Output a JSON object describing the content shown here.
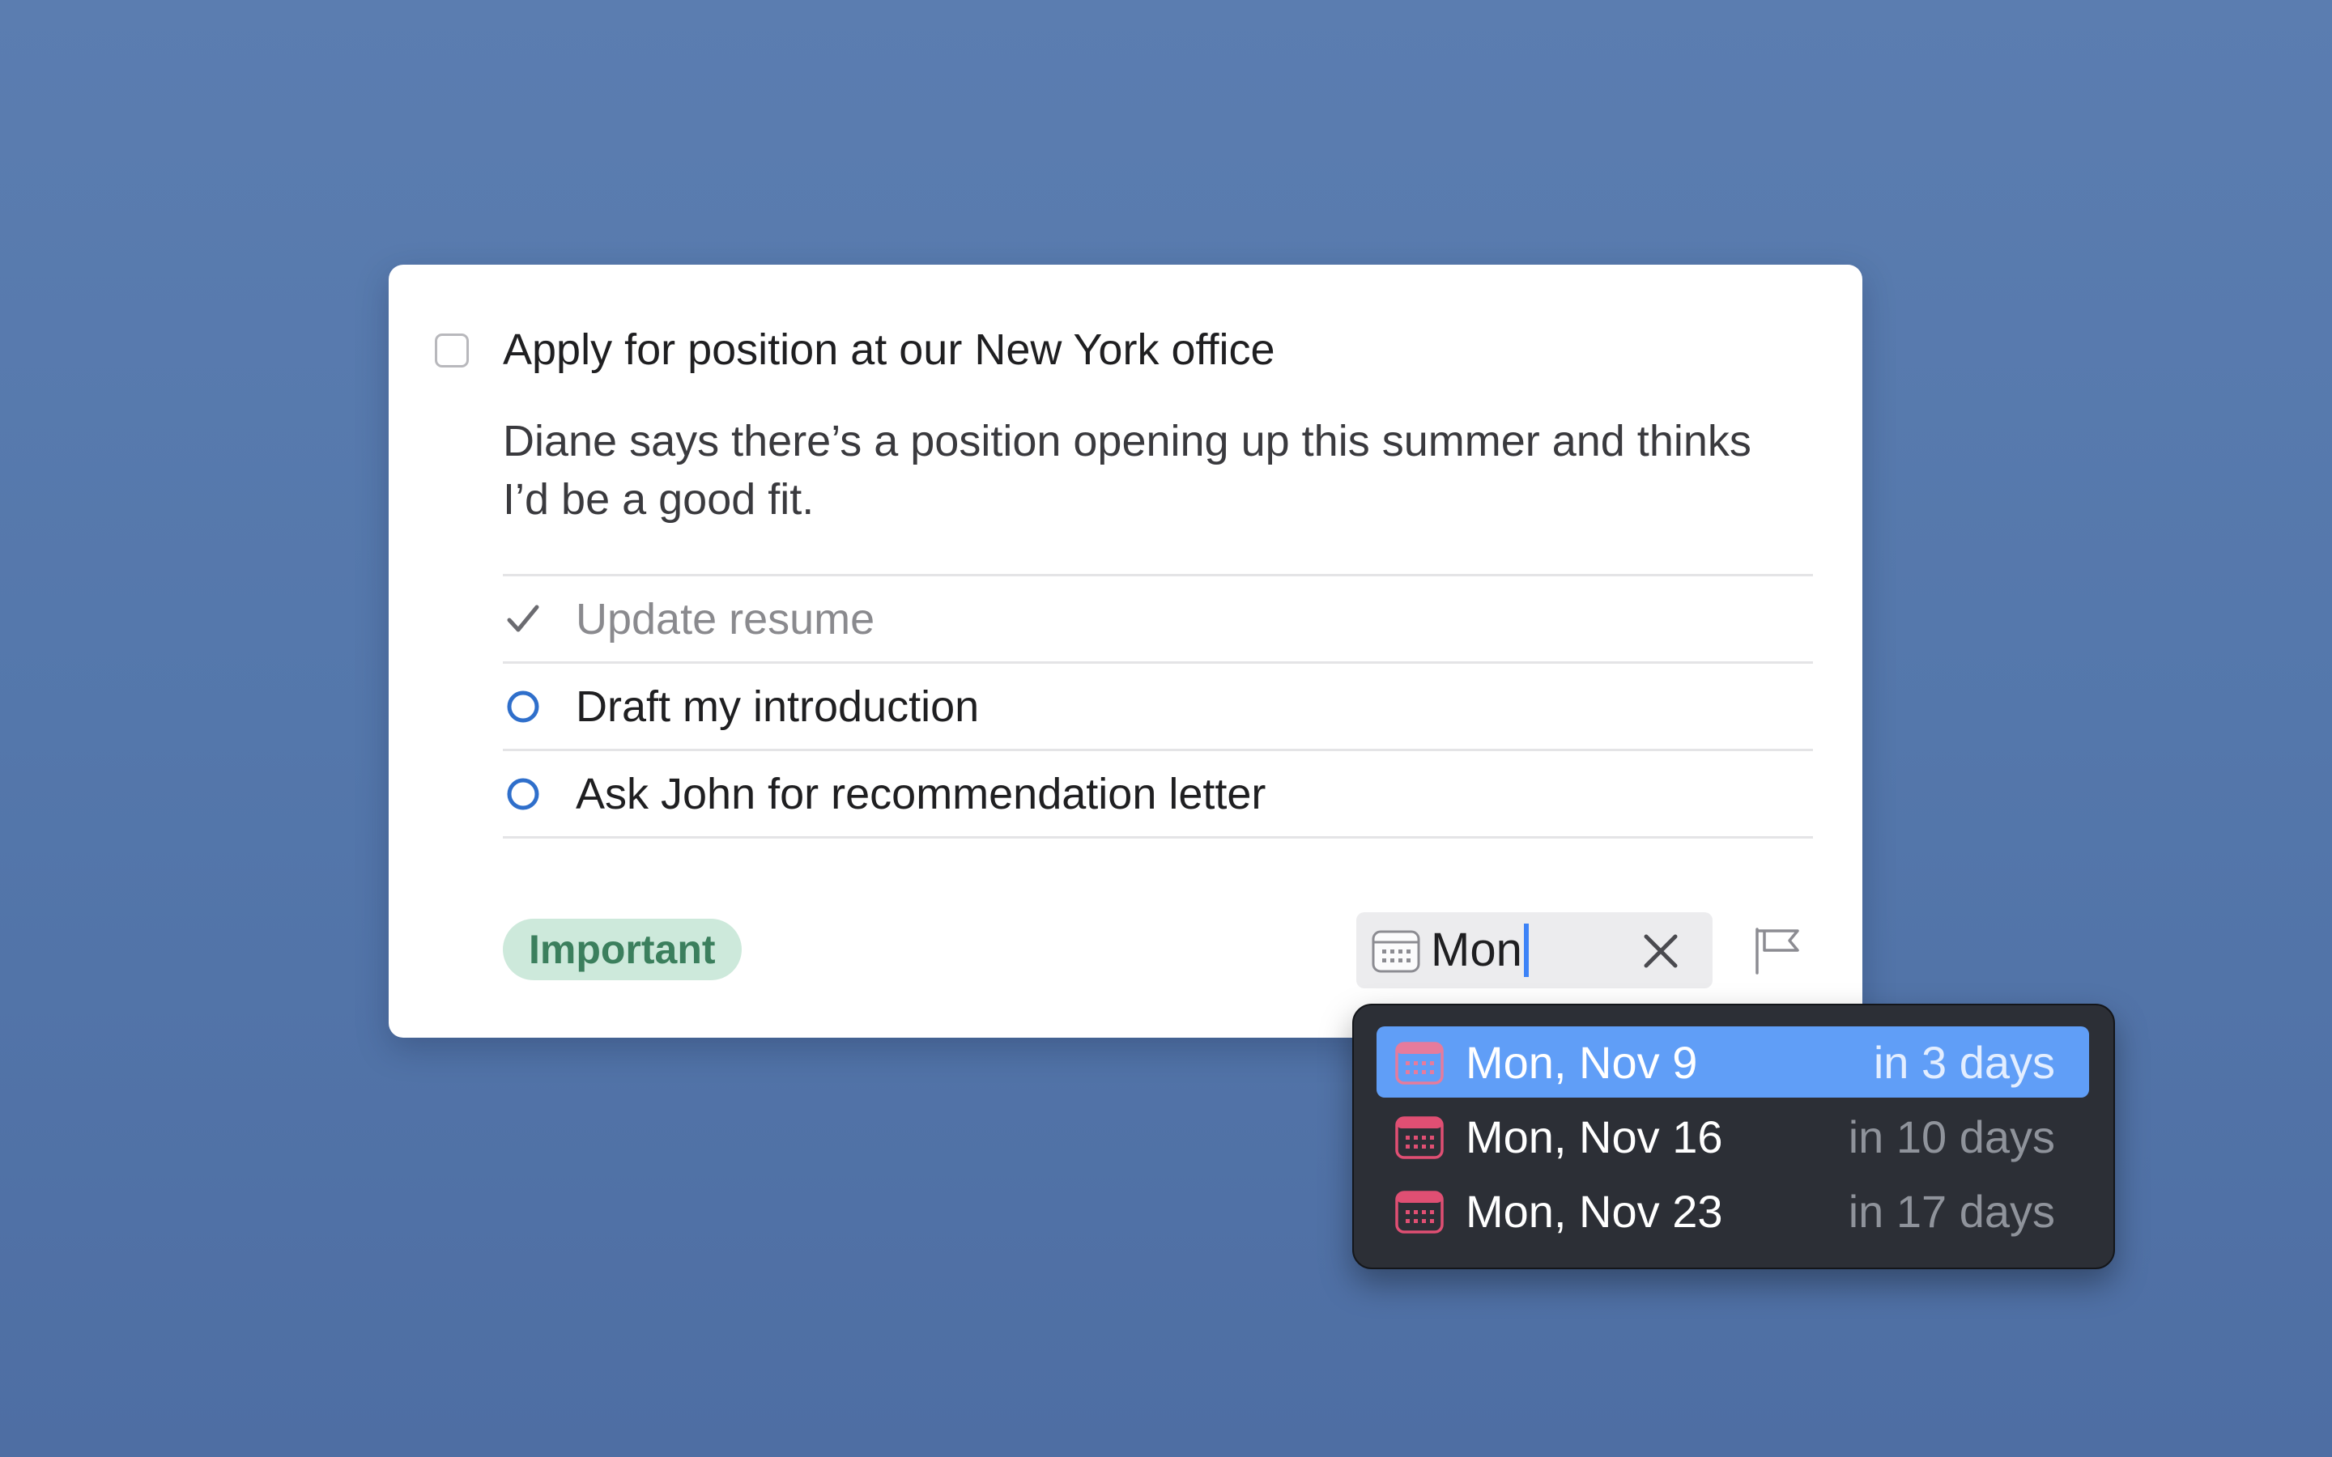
{
  "task": {
    "title": "Apply for position at our New York office",
    "notes": "Diane says there’s a position opening up this summer and thinks I’d be a good fit.",
    "completed": false
  },
  "checklist": [
    {
      "label": "Update resume",
      "done": true
    },
    {
      "label": "Draft my introduction",
      "done": false
    },
    {
      "label": "Ask John for recommendation letter",
      "done": false
    }
  ],
  "tag": {
    "label": "Important",
    "color": "#cde9db",
    "text_color": "#3b7f5d"
  },
  "deadline": {
    "input_value": "Mon",
    "icon": "calendar-icon",
    "clear_icon": "close-icon"
  },
  "flag_icon": "flag-icon",
  "suggestions": [
    {
      "date": "Mon, Nov 9",
      "relative": "in 3 days",
      "selected": true
    },
    {
      "date": "Mon, Nov 16",
      "relative": "in 10 days",
      "selected": false
    },
    {
      "date": "Mon, Nov 23",
      "relative": "in 17 days",
      "selected": false
    }
  ],
  "colors": {
    "background": "#5477ab",
    "accent": "#3d83f7",
    "selection": "#609ef7",
    "checklist_circle": "#2f6fcb",
    "calendar_icon": "#e04f73"
  }
}
